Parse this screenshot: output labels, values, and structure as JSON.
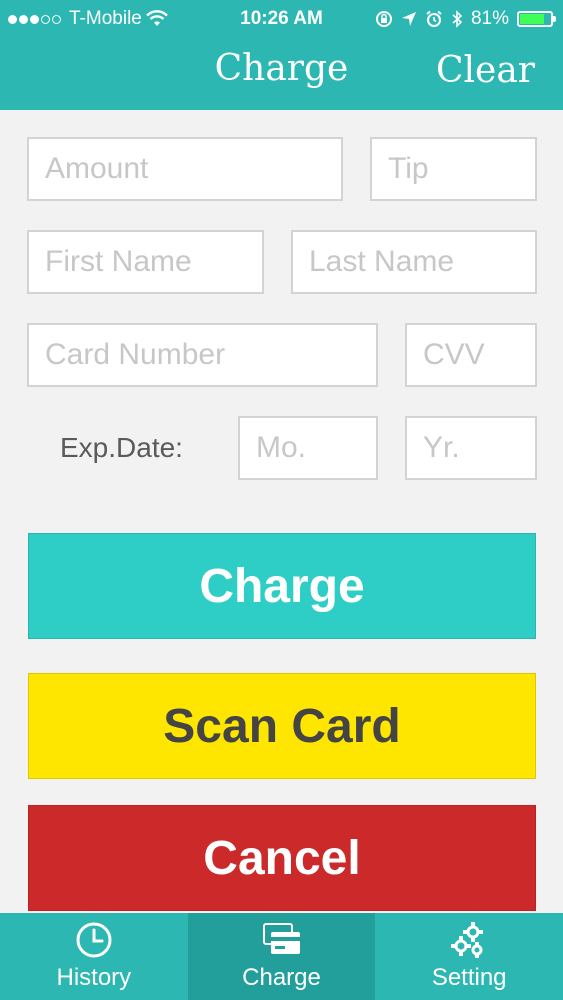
{
  "status_bar": {
    "carrier": "T-Mobile",
    "time": "10:26 AM",
    "battery": "81%",
    "battery_level": 0.81
  },
  "nav": {
    "title": "Charge",
    "right_button": "Clear"
  },
  "form": {
    "amount_placeholder": "Amount",
    "tip_placeholder": "Tip",
    "first_name_placeholder": "First Name",
    "last_name_placeholder": "Last Name",
    "card_number_placeholder": "Card Number",
    "cvv_placeholder": "CVV",
    "exp_label": "Exp.Date:",
    "month_placeholder": "Mo.",
    "year_placeholder": "Yr."
  },
  "buttons": {
    "charge": "Charge",
    "scan_card": "Scan Card",
    "cancel": "Cancel"
  },
  "tabs": [
    {
      "label": "History",
      "icon": "clock-icon",
      "active": false
    },
    {
      "label": "Charge",
      "icon": "card-icon",
      "active": true
    },
    {
      "label": "Setting",
      "icon": "gears-icon",
      "active": false
    }
  ],
  "colors": {
    "header": "#2cb7b2",
    "charge_button": "#2ecec7",
    "scan_button": "#ffe600",
    "cancel_button": "#cc2a2a"
  }
}
